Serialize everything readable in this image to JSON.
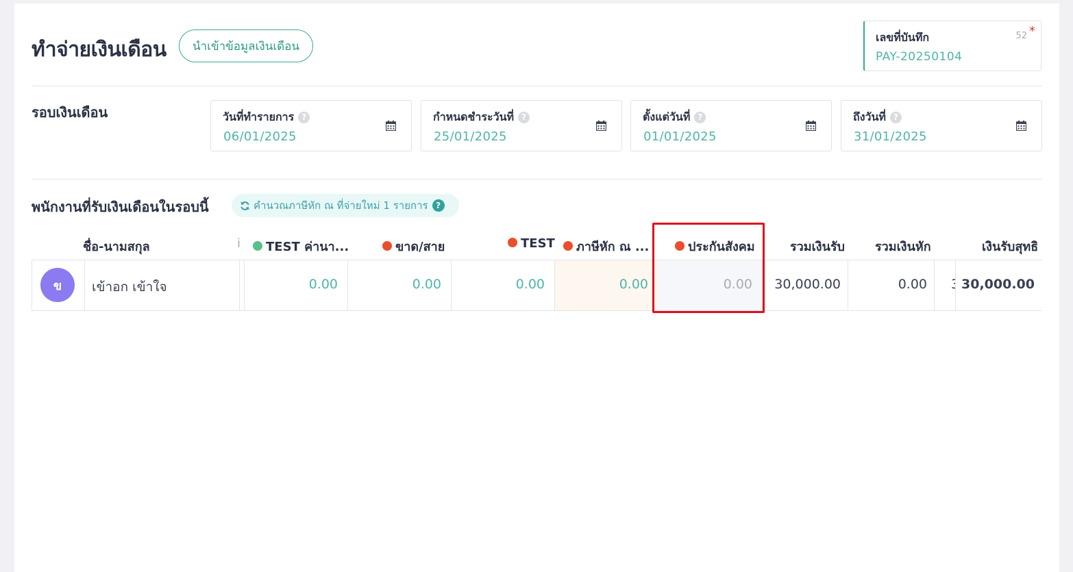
{
  "header": {
    "title": "ทำจ่ายเงินเดือน",
    "import_button": "นำเข้าข้อมูลเงินเดือน",
    "doc_number_label": "เลขที่บันทึก",
    "doc_number_count": "52",
    "doc_number_required": "*",
    "doc_number_value": "PAY-20250104"
  },
  "pay_period": {
    "section_label": "รอบเงินเดือน",
    "help_glyph": "?",
    "fields": [
      {
        "label": "วันที่ทำรายการ",
        "value": "06/01/2025"
      },
      {
        "label": "กำหนดชำระวันที่",
        "value": "25/01/2025"
      },
      {
        "label": "ตั้งแต่วันที่",
        "value": "01/01/2025"
      },
      {
        "label": "ถึงวันที่",
        "value": "31/01/2025"
      }
    ]
  },
  "employees": {
    "section_label": "พนักงานที่รับเงินเดือนในรอบนี้",
    "recalc_label": "คำนวณภาษีหัก ณ ที่จ่ายใหม่ 1 รายการ",
    "columns": {
      "name": "ชื่อ-นามสกุล",
      "info": "i",
      "c1": "TEST ค่านา...",
      "c2": "ขาด/สาย",
      "c3": "TEST",
      "c4": "ภาษีหัก ณ ...",
      "c5": "ประกันสังคม",
      "total_income": "รวมเงินรับ",
      "total_deduct": "รวมเงินหัก",
      "net": "เงินรับสุทธิ"
    },
    "colors": {
      "green_dot": "#5bbf8a",
      "red_dot": "#ea4f2d",
      "highlight": "#e0111b"
    },
    "rows": [
      {
        "avatar_initial": "ข",
        "name": "เข้าอก เข้าใจ",
        "c1": "0.00",
        "c2": "0.00",
        "c3": "0.00",
        "c4": "0.00",
        "c5": "0.00",
        "total_income": "30,000.00",
        "total_deduct": "0.00",
        "partial": "3",
        "net": "30,000.00"
      }
    ]
  }
}
